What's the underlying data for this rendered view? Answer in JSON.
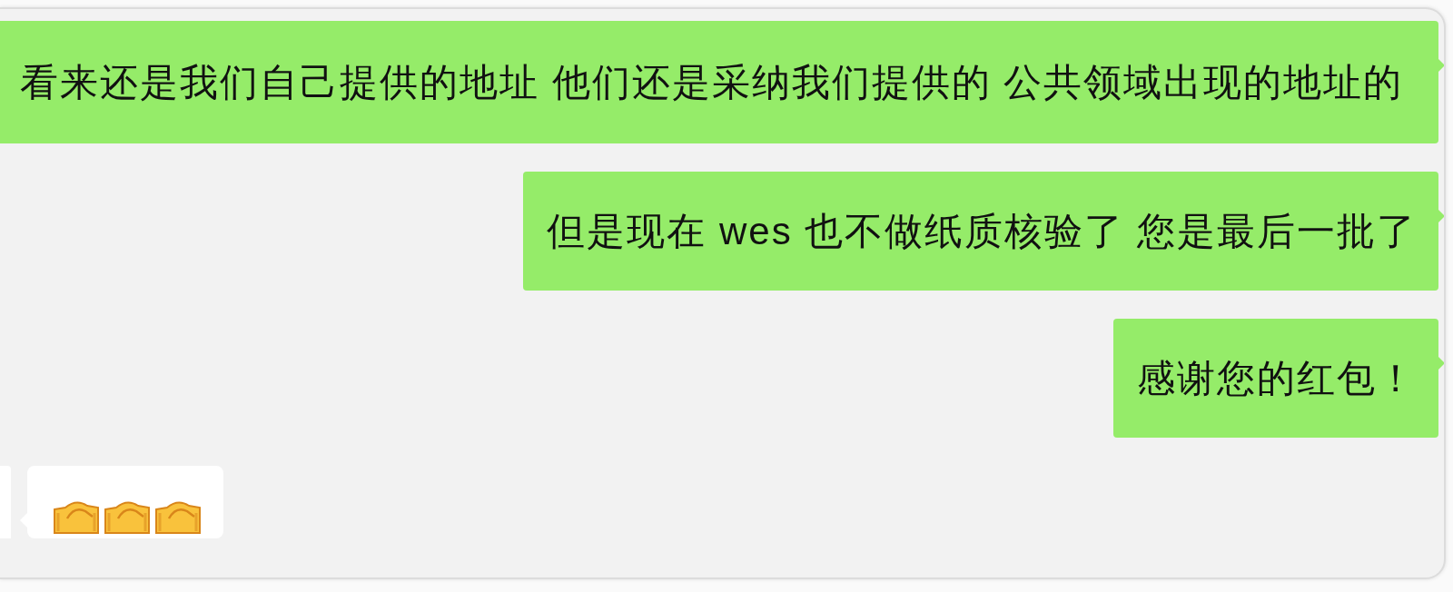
{
  "messages": [
    {
      "kind": "outgoing",
      "text": "看来还是我们自己提供的地址 他们还是采纳我们提供的 公共领域出现的地址的"
    },
    {
      "kind": "outgoing",
      "text": "但是现在 wes 也不做纸质核验了 您是最后一批了"
    },
    {
      "kind": "outgoing",
      "text": "感谢您的红包！"
    },
    {
      "kind": "incoming",
      "stickers": [
        {
          "kind": "handshake"
        },
        {
          "kind": "handshake"
        },
        {
          "kind": "handshake"
        }
      ]
    }
  ]
}
